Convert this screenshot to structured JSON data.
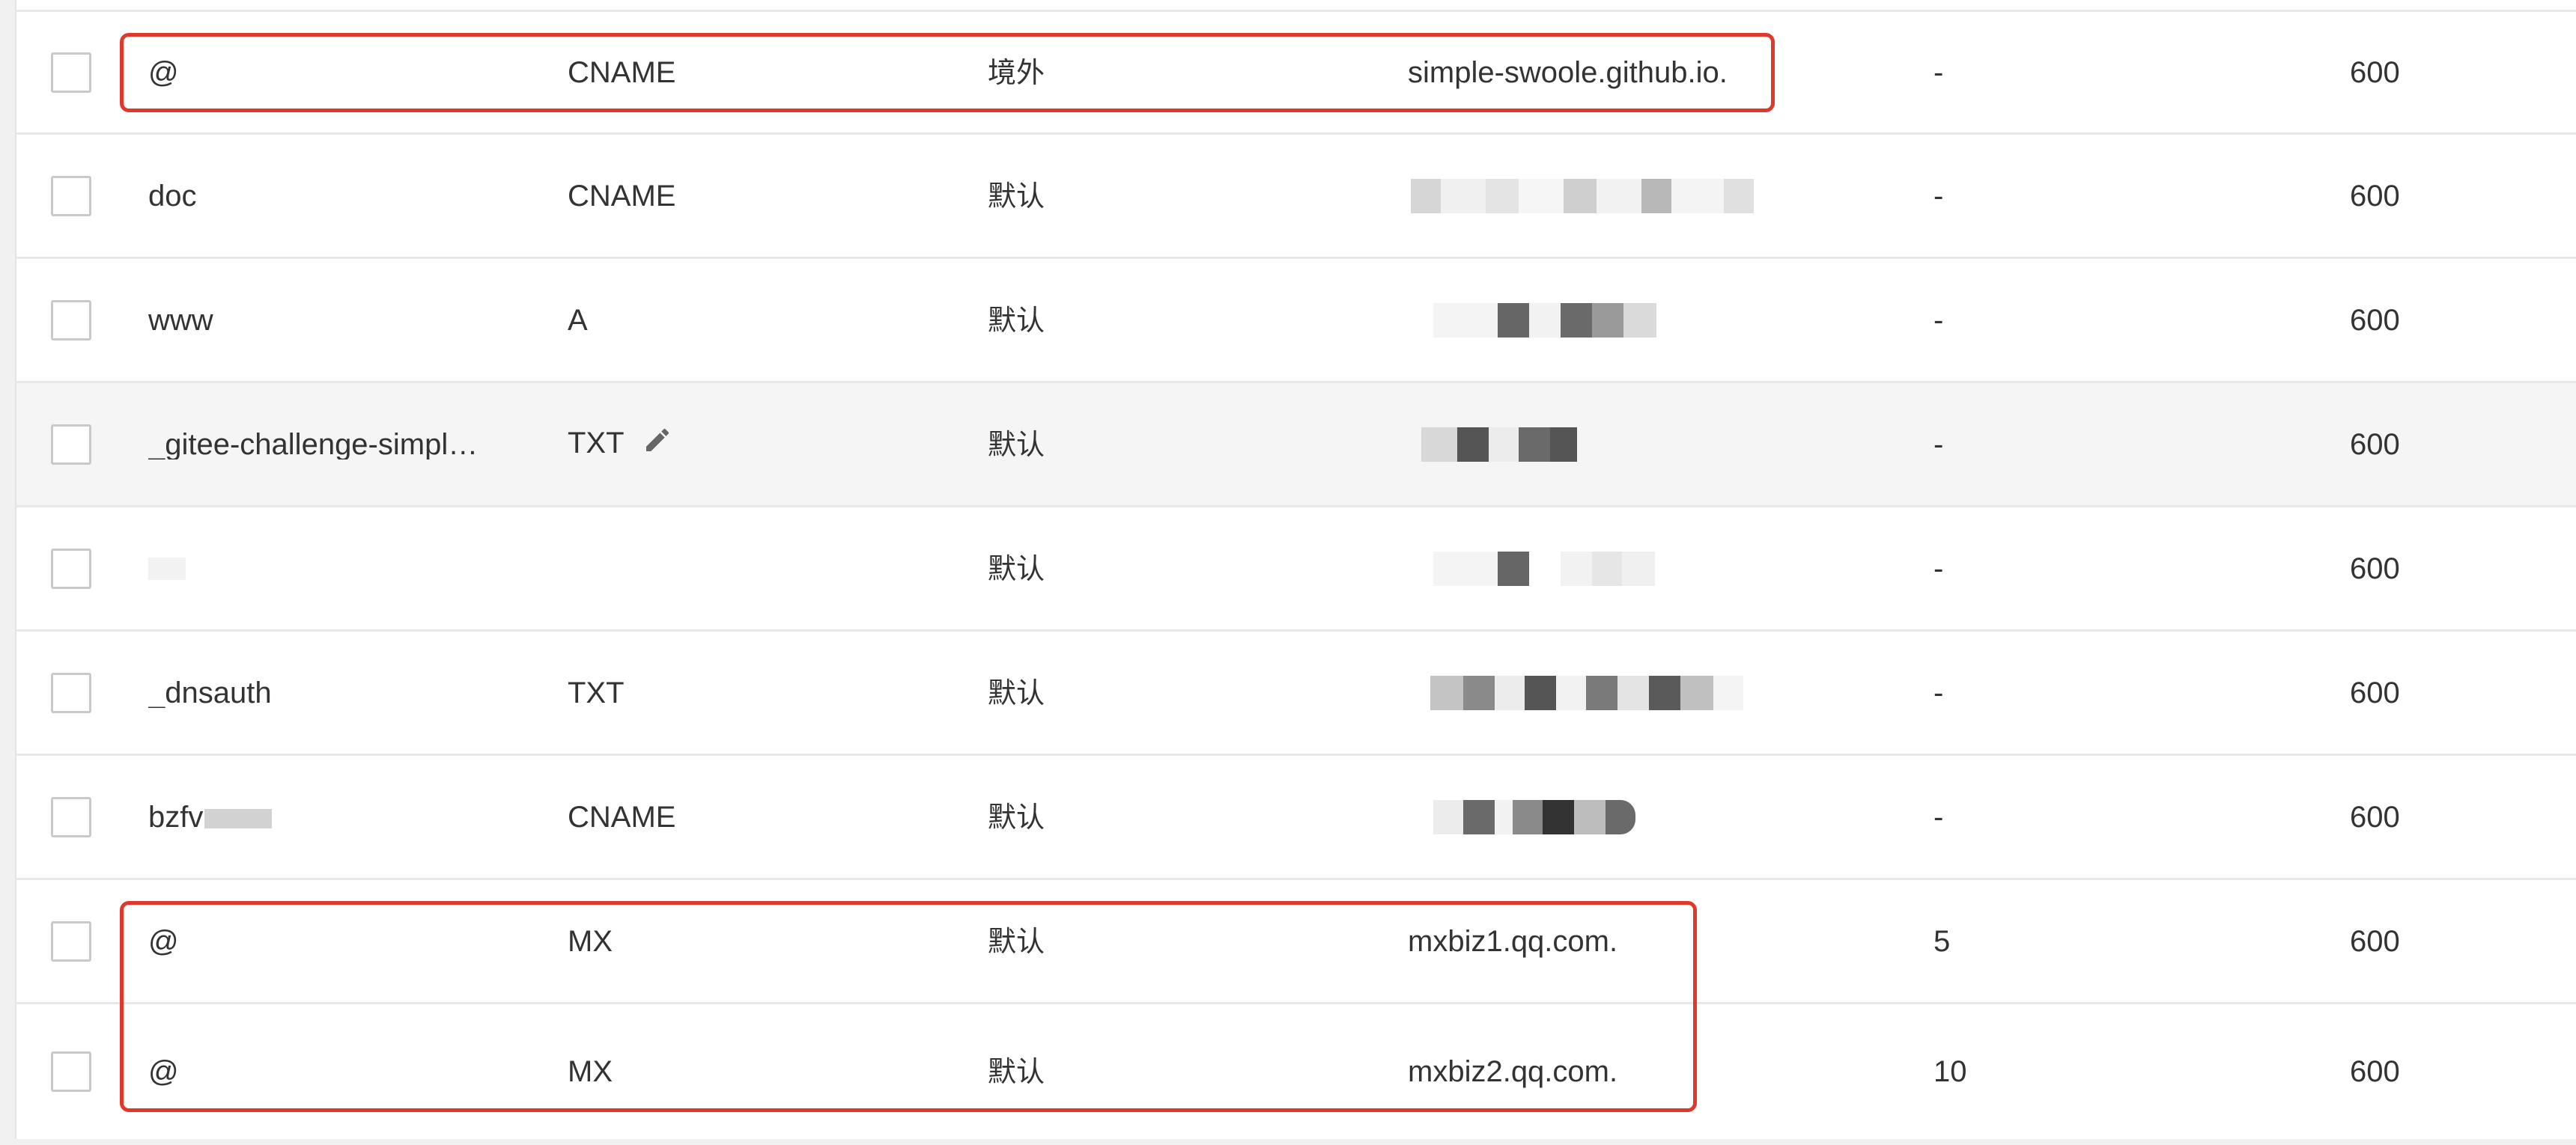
{
  "records": [
    {
      "host": "@",
      "type": "CNAME",
      "line": "境外",
      "value": "simple-swoole.github.io.",
      "priority": "-",
      "ttl": "600"
    },
    {
      "host": "doc",
      "type": "CNAME",
      "line": "默认",
      "value": "",
      "priority": "-",
      "ttl": "600"
    },
    {
      "host": "www",
      "type": "A",
      "line": "默认",
      "value": "",
      "priority": "-",
      "ttl": "600"
    },
    {
      "host": "_gitee-challenge-simpl…",
      "type": "TXT",
      "line": "默认",
      "value": "",
      "priority": "-",
      "ttl": "600"
    },
    {
      "host": "",
      "type": "",
      "line": "默认",
      "value": "",
      "priority": "-",
      "ttl": "600"
    },
    {
      "host": "_dnsauth",
      "type": "TXT",
      "line": "默认",
      "value": "",
      "priority": "-",
      "ttl": "600"
    },
    {
      "host": "bzfv",
      "type": "CNAME",
      "line": "默认",
      "value": "",
      "priority": "-",
      "ttl": "600"
    },
    {
      "host": "@",
      "type": "MX",
      "line": "默认",
      "value": "mxbiz1.qq.com.",
      "priority": "5",
      "ttl": "600"
    },
    {
      "host": "@",
      "type": "MX",
      "line": "默认",
      "value": "mxbiz2.qq.com.",
      "priority": "10",
      "ttl": "600"
    }
  ],
  "icons": {
    "edit": "pencil-icon"
  },
  "colors": {
    "highlight": "#e0392b",
    "text": "#333333",
    "row_hover": "#f5f5f5",
    "divider": "#e8e8e8"
  }
}
